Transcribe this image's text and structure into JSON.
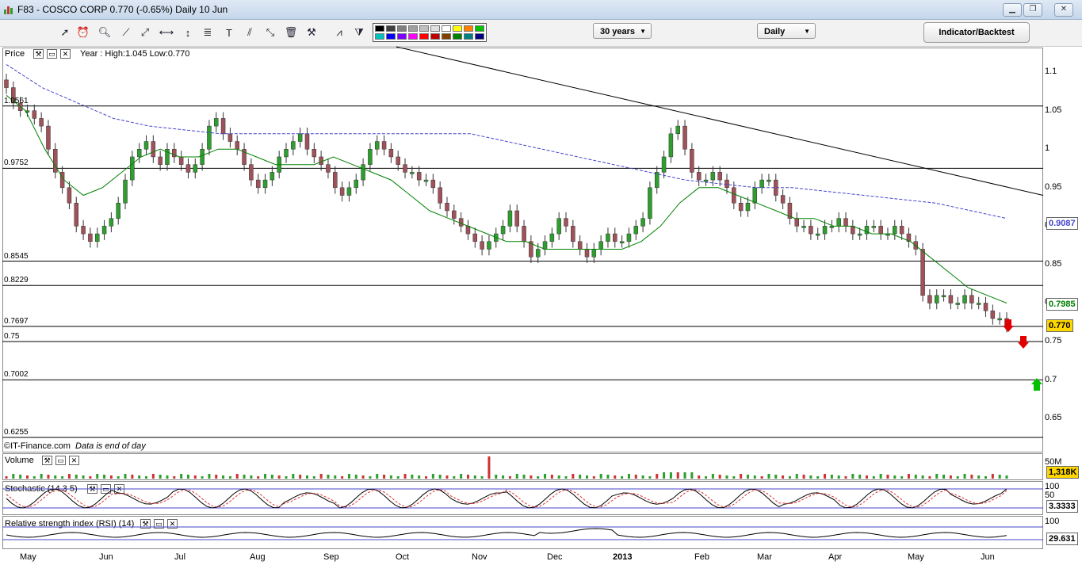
{
  "window": {
    "title": "F83 - COSCO CORP    0.770 (-0.65%)    Daily  10 Jun"
  },
  "toolbar": {
    "range_value": "30 years",
    "interval_value": "Daily",
    "indicator_button": "Indicator/Backtest",
    "icons": [
      "pointer-icon",
      "alarm-icon",
      "zoom-icon",
      "trendline-icon",
      "ray-icon",
      "horizontal-line-icon",
      "vertical-line-icon",
      "fibonacci-icon",
      "text-icon",
      "parallel-lines-icon",
      "arrow-icon",
      "trash-icon",
      "settings-icon",
      "chart-style-icon",
      "overlay-icon"
    ],
    "palette": [
      "#000000",
      "#404040",
      "#808080",
      "#a0a0a0",
      "#c0c0c0",
      "#e0e0e0",
      "#ffffff",
      "#ffff00",
      "#ff8000",
      "#00c000",
      "#00c0c0",
      "#0000ff",
      "#8000ff",
      "#ff00ff",
      "#ff0000",
      "#c00000",
      "#804000",
      "#008000",
      "#008080",
      "#000080"
    ]
  },
  "price_panel": {
    "label": "Price",
    "info": "Year : High:1.045 Low:0.770",
    "footer": "©IT-Finance.com",
    "footer_note": "Data is end of day",
    "hline_labels": [
      "1.0561",
      "0.9752",
      "0.8545",
      "0.8229",
      "0.7697",
      "0.75",
      "0.7002",
      "0.6255"
    ],
    "y_ticks": [
      "1.1",
      "1.05",
      "1",
      "0.95",
      "0.9",
      "0.85",
      "0.8",
      "0.75",
      "0.7",
      "0.65"
    ],
    "value_ma_long": "0.9087",
    "value_ma_short": "0.7985",
    "value_last": "0.770",
    "colors": {
      "ma_short": "#008000",
      "ma_long": "#4444cc",
      "up": "#2e9e2e",
      "down": "#a0525a",
      "last_bg": "#ffd700"
    }
  },
  "volume_panel": {
    "label": "Volume",
    "axis_top": "50M",
    "value": "1,318K"
  },
  "stoch_panel": {
    "label": "Stochastic (14 3 5)",
    "ticks": [
      "100",
      "50",
      "0"
    ],
    "value": "3.3333"
  },
  "rsi_panel": {
    "label": "Relative strength index (RSI) (14)",
    "ticks": [
      "100"
    ],
    "value": "29.631"
  },
  "months": [
    "May",
    "Jun",
    "Jul",
    "Aug",
    "Sep",
    "Oct",
    "Nov",
    "Dec",
    "2013",
    "Feb",
    "Mar",
    "Apr",
    "May",
    "Jun"
  ],
  "chart_data": {
    "type": "candlestick",
    "x_range": [
      "May 2012",
      "Jun 2013"
    ],
    "ylim": [
      0.61,
      1.13
    ],
    "series": [
      {
        "name": "Price",
        "values": [
          1.08,
          1.06,
          1.05,
          1.05,
          1.04,
          1.03,
          1.0,
          0.97,
          0.95,
          0.93,
          0.9,
          0.89,
          0.88,
          0.89,
          0.9,
          0.91,
          0.93,
          0.96,
          0.99,
          1.0,
          1.01,
          0.99,
          0.98,
          1.0,
          0.99,
          0.98,
          0.97,
          0.98,
          1.0,
          1.03,
          1.04,
          1.02,
          1.01,
          1.0,
          0.98,
          0.96,
          0.95,
          0.96,
          0.97,
          0.99,
          1.0,
          1.01,
          1.02,
          1.0,
          0.99,
          0.98,
          0.97,
          0.95,
          0.94,
          0.95,
          0.96,
          0.98,
          1.0,
          1.01,
          1.0,
          0.99,
          0.98,
          0.97,
          0.97,
          0.96,
          0.96,
          0.95,
          0.93,
          0.92,
          0.91,
          0.9,
          0.89,
          0.88,
          0.87,
          0.88,
          0.89,
          0.9,
          0.92,
          0.9,
          0.88,
          0.86,
          0.87,
          0.88,
          0.89,
          0.91,
          0.9,
          0.88,
          0.87,
          0.86,
          0.87,
          0.88,
          0.89,
          0.88,
          0.88,
          0.89,
          0.9,
          0.91,
          0.95,
          0.97,
          0.99,
          1.02,
          1.03,
          1.0,
          0.97,
          0.96,
          0.96,
          0.97,
          0.96,
          0.95,
          0.93,
          0.92,
          0.93,
          0.95,
          0.96,
          0.96,
          0.94,
          0.93,
          0.91,
          0.9,
          0.9,
          0.89,
          0.89,
          0.9,
          0.9,
          0.91,
          0.9,
          0.89,
          0.89,
          0.9,
          0.9,
          0.89,
          0.89,
          0.9,
          0.89,
          0.88,
          0.87,
          0.81,
          0.8,
          0.81,
          0.81,
          0.8,
          0.8,
          0.81,
          0.8,
          0.8,
          0.79,
          0.78,
          0.78,
          0.77
        ]
      },
      {
        "name": "MA short",
        "values": [
          1.07,
          1.05,
          1.0,
          0.96,
          0.94,
          0.95,
          0.97,
          0.99,
          1.0,
          0.99,
          0.99,
          1.0,
          1.0,
          0.99,
          0.98,
          0.98,
          0.98,
          0.99,
          0.98,
          0.97,
          0.96,
          0.94,
          0.92,
          0.91,
          0.9,
          0.89,
          0.88,
          0.88,
          0.87,
          0.87,
          0.87,
          0.87,
          0.87,
          0.88,
          0.9,
          0.93,
          0.95,
          0.95,
          0.94,
          0.93,
          0.92,
          0.91,
          0.91,
          0.9,
          0.9,
          0.89,
          0.89,
          0.88,
          0.86,
          0.84,
          0.82,
          0.81,
          0.8
        ]
      },
      {
        "name": "MA long",
        "values": [
          1.11,
          1.08,
          1.06,
          1.04,
          1.03,
          1.025,
          1.02,
          1.02,
          1.02,
          1.02,
          1.02,
          1.02,
          1.02,
          1.02,
          1.01,
          1.0,
          0.99,
          0.98,
          0.97,
          0.96,
          0.955,
          0.95,
          0.95,
          0.945,
          0.94,
          0.935,
          0.93,
          0.92,
          0.91
        ]
      }
    ]
  }
}
